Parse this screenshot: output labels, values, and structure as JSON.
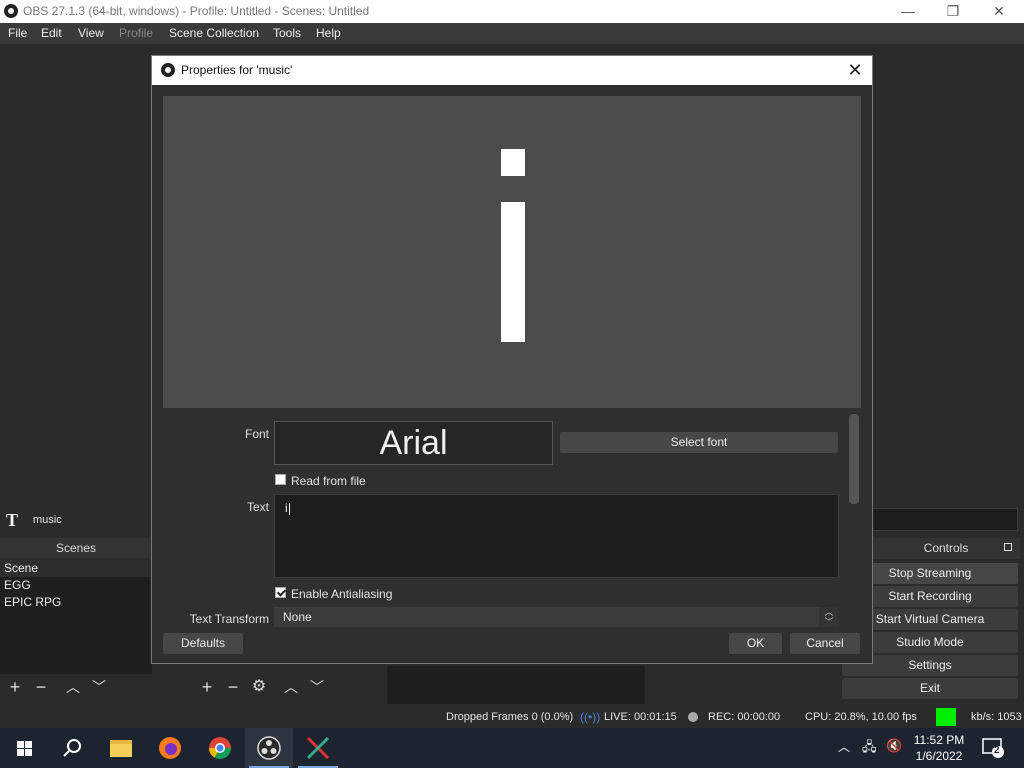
{
  "window": {
    "title": "OBS 27.1.3 (64-bit, windows) - Profile: Untitled - Scenes: Untitled",
    "minimize": "—",
    "maximize": "❐",
    "close": "✕"
  },
  "menu": [
    {
      "label": "File",
      "enabled": true
    },
    {
      "label": "Edit",
      "enabled": true
    },
    {
      "label": "View",
      "enabled": true
    },
    {
      "label": "Profile",
      "enabled": false
    },
    {
      "label": "Scene Collection",
      "enabled": true
    },
    {
      "label": "Tools",
      "enabled": true
    },
    {
      "label": "Help",
      "enabled": true
    }
  ],
  "source_bar": {
    "icon": "text-source-icon",
    "name": "music"
  },
  "scenes": {
    "title": "Scenes",
    "items": [
      "Scene",
      "EGG",
      "EPIC RPG"
    ]
  },
  "controls": {
    "title": "Controls",
    "buttons": [
      "Stop Streaming",
      "Start Recording",
      "Start Virtual Camera",
      "Studio Mode",
      "Settings",
      "Exit"
    ]
  },
  "status": {
    "dropped_frames": "Dropped Frames 0 (0.0%)",
    "live": "LIVE: 00:01:15",
    "rec": "REC: 00:00:00",
    "cpu": "CPU: 20.8%, 10.00 fps",
    "kbs": "kb/s: 1053",
    "status_color": "#00ee00"
  },
  "dialog": {
    "title": "Properties for 'music'",
    "preview_text": "i",
    "font_label": "Font",
    "font_name": "Arial",
    "select_font": "Select font",
    "read_from_file": "Read from file",
    "read_from_file_checked": false,
    "text_label": "Text",
    "text_value": "i",
    "antialias_label": "Enable Antialiasing",
    "antialias_checked": true,
    "transform_label": "Text Transform",
    "transform_value": "None",
    "defaults": "Defaults",
    "ok": "OK",
    "cancel": "Cancel"
  },
  "taskbar": {
    "time": "11:52 PM",
    "date": "1/6/2022",
    "notifications": "2"
  }
}
